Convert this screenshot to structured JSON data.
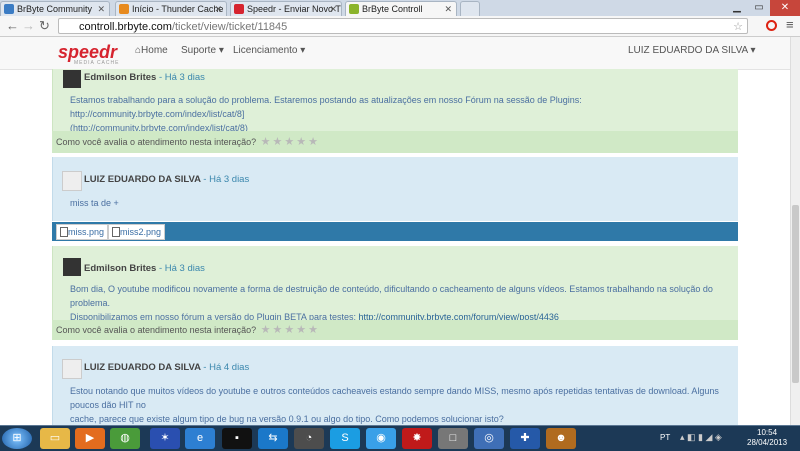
{
  "browser": {
    "tabs": [
      {
        "label": "BrByte Community",
        "color": "#3b7cc4"
      },
      {
        "label": "Início - Thunder Cache Pr",
        "color": "#e78a1e"
      },
      {
        "label": "Speedr - Enviar Novo Tópi",
        "color": "#d6242f"
      },
      {
        "label": "BrByte Controll",
        "color": "#8bb42b"
      }
    ],
    "url_host": "controll.brbyte.com",
    "url_path": "/ticket/view/ticket/11845"
  },
  "navbar": {
    "logo": "speedr",
    "logo_sub": "MEDIA CACHE",
    "home": "Home",
    "support": "Suporte",
    "licensing": "Licenciamento",
    "user": "LUIZ EDUARDO DA SILVA"
  },
  "posts": [
    {
      "author": "Edmilson Brites",
      "when": "- Há 3 dias",
      "body_lines": [
        "Estamos trabalhando para a solução do problema. Estaremos postando as atualizações em nosso Fórum na sessão de Plugins: http://community.brbyte.com/index/list/cat/8]",
        "(http://community.brbyte.com/index/list/cat/8)"
      ],
      "rating_label": "Como você avalia o atendimento nesta interação?"
    },
    {
      "author": "LUIZ EDUARDO DA SILVA",
      "when": "- Há 3 dias",
      "body_lines": [
        "miss ta de +"
      ],
      "attachments": [
        "miss.png",
        "miss2.png"
      ]
    },
    {
      "author": "Edmilson Brites",
      "when": "- Há 3 dias",
      "body_lines": [
        "Bom dia, O youtube modificou novamente a forma de destruição de conteúdo, dificultando o cacheamento de alguns vídeos. Estamos trabalhando na solução do problema.",
        "Disponibilizamos em nosso fórum a versão do Plugin BETA para testes:"
      ],
      "link": "http://community.brbyte.com/forum/view/post/4436",
      "rating_label": "Como você avalia o atendimento nesta interação?"
    },
    {
      "author": "LUIZ EDUARDO DA SILVA",
      "when": "- Há 4 dias",
      "body_lines": [
        "Estou notando que muitos vídeos do youtube e outros conteúdos cacheaveis estando sempre dando MISS, mesmo após repetidas tentativas de download. Alguns poucos dão HIT no",
        "cache, parece que existe algum tipo de bug na versão 0.9.1 ou algo do tipo. Como podemos solucionar isto?"
      ]
    }
  ],
  "taskbar": {
    "lang": "PT",
    "time": "10:54",
    "date": "28/04/2013"
  }
}
